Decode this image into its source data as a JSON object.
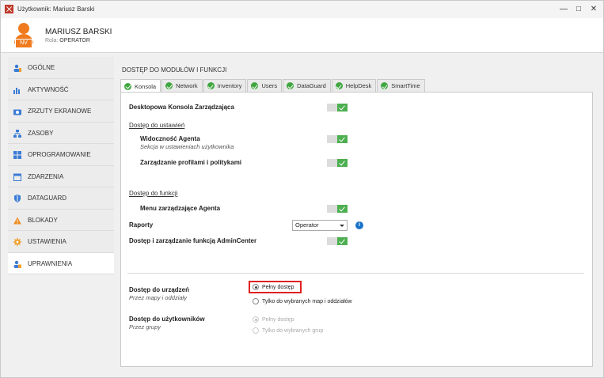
{
  "window": {
    "title": "Użytkownik: Mariusz Barski",
    "controls": [
      "minimize-icon",
      "maximize-icon",
      "close-icon"
    ]
  },
  "header": {
    "avatar_initials": "NV",
    "user_name": "MARIUSZ BARSKI",
    "role_label": "Rola:",
    "role_value": "OPERATOR",
    "avatar_color": "#f07b1e"
  },
  "sidebar": {
    "items": [
      {
        "label": "OGÓLNE",
        "icon": "user-icon"
      },
      {
        "label": "AKTYWNOŚĆ",
        "icon": "bar-chart-icon"
      },
      {
        "label": "ZRZUTY EKRANOWE",
        "icon": "camera-icon"
      },
      {
        "label": "ZASOBY",
        "icon": "network-icon"
      },
      {
        "label": "OPROGRAMOWANIE",
        "icon": "software-icon"
      },
      {
        "label": "ZDARZENIA",
        "icon": "calendar-icon"
      },
      {
        "label": "DATAGUARD",
        "icon": "shield-icon"
      },
      {
        "label": "BLOKADY",
        "icon": "warning-icon"
      },
      {
        "label": "USTAWIENIA",
        "icon": "gear-icon"
      },
      {
        "label": "UPRAWNIENIA",
        "icon": "user-lock-icon",
        "active": true
      }
    ]
  },
  "main": {
    "section_title": "DOSTĘP DO MODUŁÓW I FUNKCJI",
    "tabs": [
      {
        "label": "Konsola",
        "active": true
      },
      {
        "label": "Network"
      },
      {
        "label": "Inventory"
      },
      {
        "label": "Users"
      },
      {
        "label": "DataGuard"
      },
      {
        "label": "HelpDesk"
      },
      {
        "label": "SmartTime"
      }
    ],
    "desktop_console": "Desktopowa Konsola Zarządzająca",
    "settings_access": "Dostęp do ustawień",
    "agent_visibility": "Widoczność Agenta",
    "agent_visibility_sub": "Sekcja w ustawieniach użytkownika",
    "profiles_management": "Zarządzanie profilami i politykami",
    "functions_access": "Dostęp do funkcji",
    "agent_menu": "Menu zarządzające Agenta",
    "reports": "Raporty",
    "reports_value": "Operator",
    "admincenter": "Dostęp i zarządzanie funkcją AdminCenter",
    "devices_access": "Dostęp do urządzeń",
    "devices_access_sub": "Przez mapy i oddziały",
    "devices_full": "Pełny dostęp",
    "devices_selected": "Tylko do wybranych map i oddziałów",
    "users_access": "Dostęp do użytkowników",
    "users_access_sub": "Przez grupy",
    "users_full": "Pełny dostęp",
    "users_selected": "Tylko do wybranych grup",
    "toggle_on_color": "#4caf50",
    "highlight_color": "#e02020"
  }
}
